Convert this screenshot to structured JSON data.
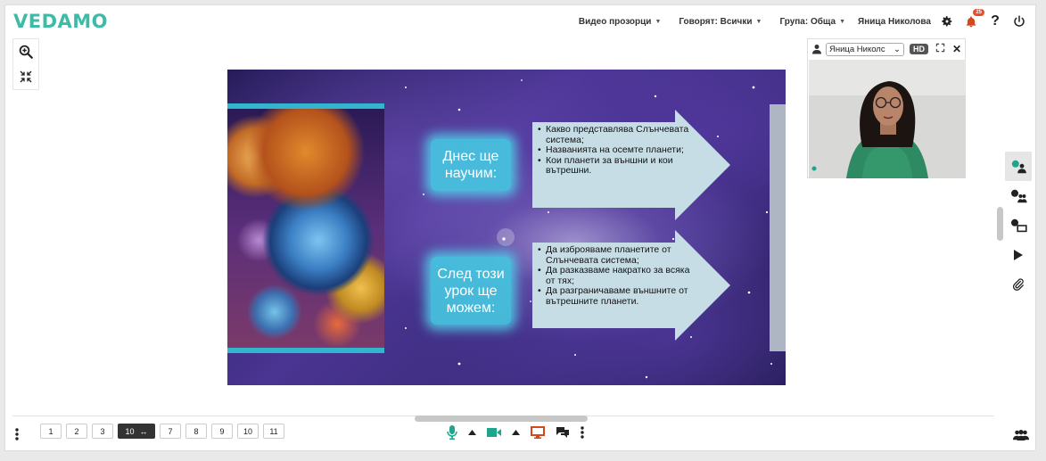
{
  "app": {
    "logo": "VEDAMO"
  },
  "header": {
    "video_windows": "Видео прозорци",
    "speaking": "Говорят: Всички",
    "group": "Група: Обща",
    "user_name": "Яница Николова",
    "notifications_count": "25"
  },
  "slide": {
    "box_top": "Днес ще научим:",
    "box_bottom": "След този урок ще можем:",
    "list_top": [
      "Какво представлява Слънчевата система;",
      "Названията на осемте планети;",
      "Кои планети за външни и кои вътрешни."
    ],
    "list_bottom": [
      "Да изброяваме планетите от Слънчевата система;",
      "Да разказваме накратко за всяка от тях;",
      "Да разграничаваме външните от вътрешните планети."
    ]
  },
  "video": {
    "participant": "Яница Николс",
    "hd_label": "HD"
  },
  "pages": {
    "items": [
      "1",
      "2",
      "3",
      "10",
      "7",
      "8",
      "9",
      "10",
      "11"
    ],
    "active_index": 3
  },
  "colors": {
    "brand": "#3dbba6",
    "accent_teal": "#32b6cf",
    "mic": "#1fa58c",
    "screen": "#d4481c"
  }
}
